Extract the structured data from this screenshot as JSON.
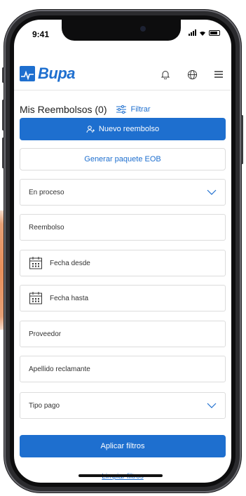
{
  "status_bar": {
    "time": "9:41"
  },
  "app": {
    "brand": "Bupa"
  },
  "header_icons": [
    "bell-icon",
    "globe-icon",
    "menu-icon"
  ],
  "page": {
    "title": "Mis Reembolsos (0)",
    "filter_label": "Filtrar"
  },
  "actions": {
    "new_claim": "Nuevo reembolso",
    "eob": "Generar paquete EOB"
  },
  "filters": {
    "status": "En proceso",
    "claim": "Reembolso",
    "date_from": "Fecha desde",
    "date_to": "Fecha hasta",
    "provider": "Proveedor",
    "claimant_lastname": "Apellido reclamante",
    "payment_type": "Tipo pago"
  },
  "footer": {
    "apply": "Aplicar filtros",
    "clear": "Limpiar filtros"
  },
  "colors": {
    "brand": "#1e6fcf",
    "border": "#dcdcdc"
  }
}
